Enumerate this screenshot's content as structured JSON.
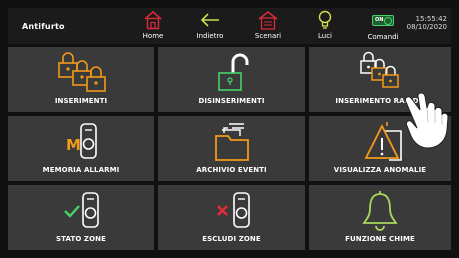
{
  "header": {
    "title": "Antifurto",
    "nav": [
      {
        "label": "Home",
        "icon": "home-icon",
        "color": "#d92a3a"
      },
      {
        "label": "Indietro",
        "icon": "back-arrow-icon",
        "color": "#c5e04a"
      },
      {
        "label": "Scenari",
        "icon": "scenarios-icon",
        "color": "#d92a3a"
      },
      {
        "label": "Luci",
        "icon": "lightbulb-icon",
        "color": "#d9e04a"
      },
      {
        "label": "Comandi",
        "icon": "on-toggle-icon",
        "color": "#47d36b"
      }
    ],
    "toggle_text": "ON",
    "time": "15:55:42",
    "date": "08/10/2020"
  },
  "tiles": [
    {
      "label": "INSERIMENTI",
      "icon": "locked-padlocks-icon"
    },
    {
      "label": "DISINSERIMENTI",
      "icon": "unlocked-padlock-icon"
    },
    {
      "label": "INSERIMENTO RAPIDO",
      "icon": "quick-arm-padlocks-icon"
    },
    {
      "label": "MEMORIA ALLARMI",
      "icon": "alarm-memory-sensor-icon",
      "badge": "M"
    },
    {
      "label": "ARCHIVIO EVENTI",
      "icon": "event-archive-folder-icon"
    },
    {
      "label": "VISUALIZZA ANOMALIE",
      "icon": "warning-anomaly-icon"
    },
    {
      "label": "STATO ZONE",
      "icon": "zone-status-check-icon"
    },
    {
      "label": "ESCLUDI ZONE",
      "icon": "exclude-zone-x-icon"
    },
    {
      "label": "FUNZIONE CHIME",
      "icon": "chime-bell-icon"
    }
  ],
  "colors": {
    "accent_orange": "#f29a1a",
    "accent_green": "#47d36b",
    "accent_red": "#e52b3a",
    "tile_bg": "#3a3a3a",
    "bar_bg": "#1b1b1b"
  }
}
